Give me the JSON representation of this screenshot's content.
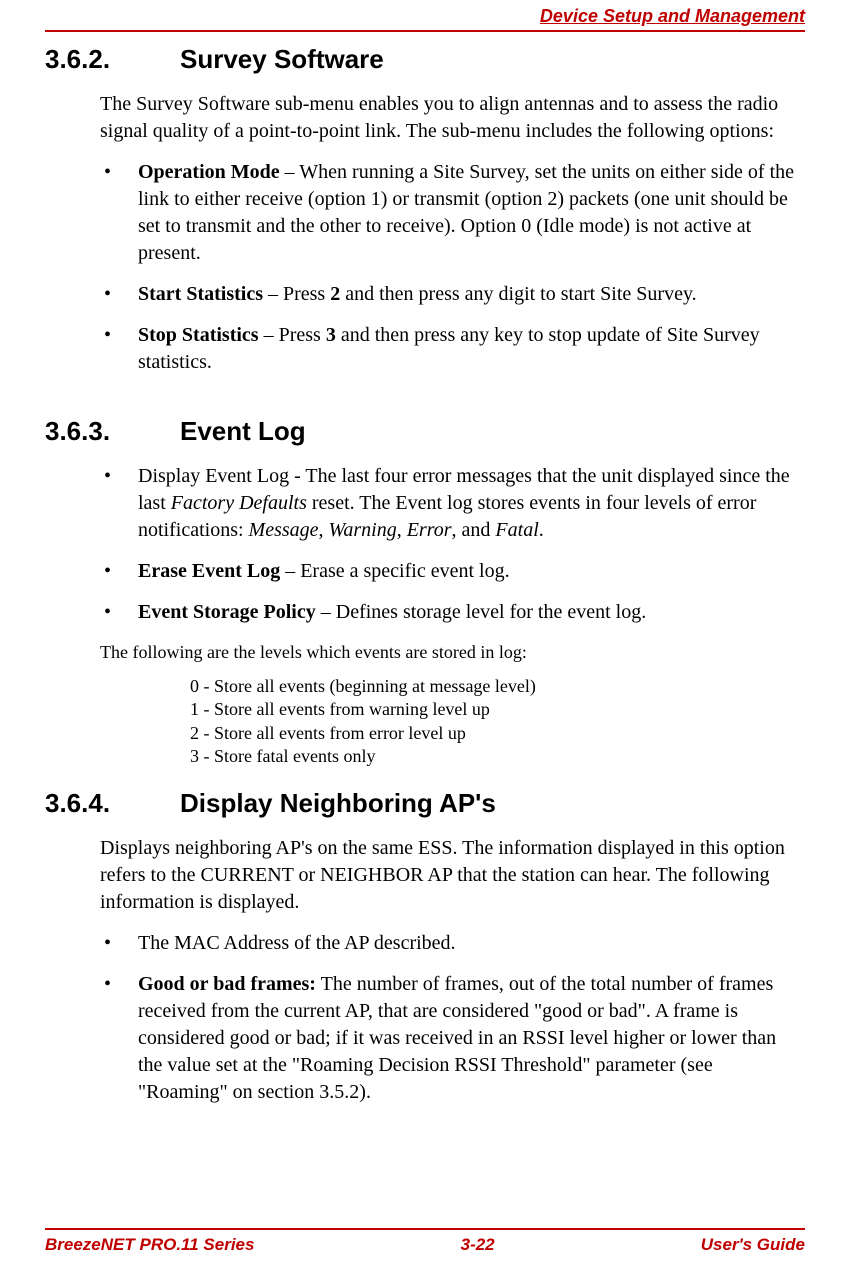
{
  "header": {
    "title": "Device Setup and Management"
  },
  "sections": {
    "s362": {
      "num": "3.6.2.",
      "title": "Survey Software",
      "intro": "The Survey Software sub-menu enables you to align antennas and to assess the radio signal quality of a point-to-point link. The sub-menu includes the following options:",
      "b1_label": "Operation Mode",
      "b1_text": " – When running a Site Survey, set the units on either side of the link to either receive (option 1) or transmit (option 2) packets (one unit should be set to transmit and the other to receive). Option 0 (Idle mode) is not active at present.",
      "b2_label": "Start Statistics",
      "b2_text_a": " – Press ",
      "b2_key": "2",
      "b2_text_b": " and then press any digit to start Site Survey.",
      "b3_label": "Stop Statistics",
      "b3_text_a": " – Press ",
      "b3_key": "3",
      "b3_text_b": " and then press any key to stop update of Site Survey statistics."
    },
    "s363": {
      "num": "3.6.3.",
      "title": "Event Log",
      "b1_text_a": "Display Event Log - The last four error messages that the unit displayed since the last ",
      "b1_italic1": "Factory Defaults",
      "b1_text_b": " reset. The Event log stores events in four levels of error notifications: ",
      "b1_i2": "Message",
      "b1_c1": ", ",
      "b1_i3": "Warning",
      "b1_c2": ", ",
      "b1_i4": "Error",
      "b1_c3": ", and ",
      "b1_i5": "Fatal",
      "b1_c4": ".",
      "b2_label": "Erase Event Log",
      "b2_text": " – Erase a specific event log.",
      "b3_label": "Event Storage Policy",
      "b3_text": " – Defines storage level for the event log.",
      "levels_intro": "The following are the levels which events are stored in log:",
      "lvl0": "0 - Store all events (beginning at message level)",
      "lvl1": "1 - Store all events from warning level up",
      "lvl2": "2 - Store all events from error level up",
      "lvl3": "3 - Store fatal events only"
    },
    "s364": {
      "num": "3.6.4.",
      "title": "Display Neighboring AP's",
      "intro": "Displays neighboring AP's on the same ESS. The information displayed in this option refers to the CURRENT or NEIGHBOR AP that the station can hear. The following information is displayed.",
      "b1_text": "The MAC Address of the AP described.",
      "b2_label": "Good or bad frames:",
      "b2_text": " The number of frames, out of the total number of frames received from the current AP, that are considered \"good or bad\". A frame is considered good or bad; if it was received in an RSSI level higher or lower than the value set at the \"Roaming Decision RSSI Threshold\" parameter (see \"Roaming\" on section 3.5.2)."
    }
  },
  "footer": {
    "left": "BreezeNET PRO.11 Series",
    "center": "3-22",
    "right": "User's Guide"
  }
}
